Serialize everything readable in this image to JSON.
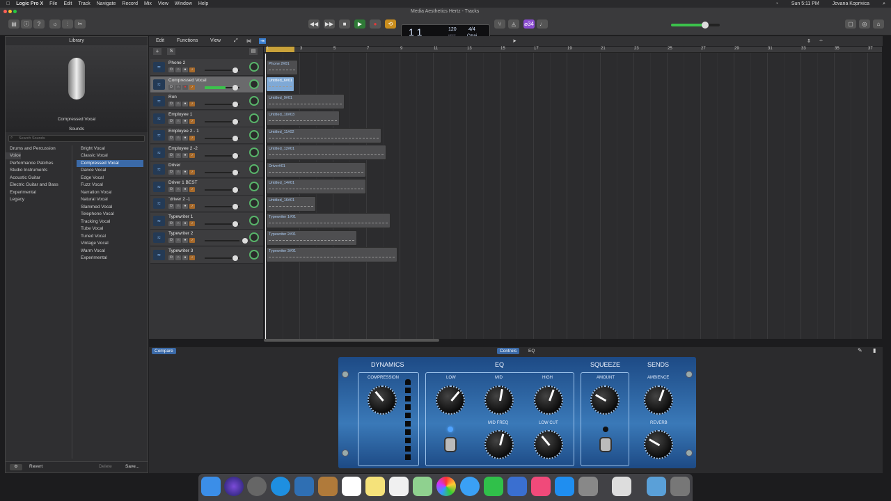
{
  "menubar": {
    "app": "Logic Pro X",
    "items": [
      "File",
      "Edit",
      "Track",
      "Navigate",
      "Record",
      "Mix",
      "View",
      "Window",
      "Help"
    ],
    "right": [
      "Sun 5:11 PM",
      "Jovana Koprivica"
    ]
  },
  "window": {
    "title": "Media Aesthetics Hertz - Tracks"
  },
  "lcd": {
    "position": "1 1",
    "bar_label": "BAR",
    "beat_label": "BEAT",
    "tempo": "120",
    "tempo_label": "KEEP",
    "tempo_sub": "TEMPO",
    "sig": "4/4",
    "key": "Cmaj"
  },
  "toolbar_right": {
    "badge": "⌀34"
  },
  "library": {
    "title": "Library",
    "patch_name": "Compressed Vocal",
    "sounds_label": "Sounds",
    "search_placeholder": "Search Sounds",
    "categories": [
      "Drums and Percussion",
      "Voice",
      "Performance Patches",
      "Studio Instruments",
      "Acoustic Guitar",
      "Electric Guitar and Bass",
      "Experimental",
      "Legacy"
    ],
    "patches": [
      "Bright Vocal",
      "Classic Vocal",
      "Compressed Vocal",
      "Dance Vocal",
      "Edge Vocal",
      "Fuzz Vocal",
      "Narration Vocal",
      "Natural Vocal",
      "Slammed Vocal",
      "Telephone Vocal",
      "Tracking Vocal",
      "Tube Vocal",
      "Tuned Vocal",
      "Vintage Vocal",
      "Warm Vocal",
      "Experimental"
    ],
    "revert": "Revert",
    "delete": "Delete",
    "save": "Save..."
  },
  "editor_menu": [
    "Edit",
    "Functions",
    "View"
  ],
  "ruler": [
    "1",
    "3",
    "5",
    "7",
    "9",
    "11",
    "13",
    "15",
    "17",
    "19",
    "21",
    "23",
    "25",
    "27",
    "29",
    "31",
    "33",
    "35",
    "37"
  ],
  "tracks": [
    {
      "name": "Phone 2",
      "region": "Phone 2#01"
    },
    {
      "name": "Compressed Vocal",
      "region": "Untitled_6#01"
    },
    {
      "name": "Ron",
      "region": "Untitled_9#01"
    },
    {
      "name": "Employee 1",
      "region": "Untitled_10#03"
    },
    {
      "name": "Employee 2 - 1",
      "region": "Untitled_11#02"
    },
    {
      "name": "Employee 2 -2",
      "region": "Untitled_12#01"
    },
    {
      "name": "Driver",
      "region": "Driver#01"
    },
    {
      "name": "Driver 1  BEST",
      "region": "Untitled_14#01"
    },
    {
      "name": "`driver 2 -1",
      "region": "Untitled_16#01"
    },
    {
      "name": "Typewriter 1",
      "region": "Typewriter 1#01"
    },
    {
      "name": "Typewriter 2",
      "region": "Typewriter 2#01"
    },
    {
      "name": "Typewriter 3",
      "region": "Typewriter 3#01"
    }
  ],
  "smart_controls": {
    "compare": "Compare",
    "tab_controls": "Controls",
    "tab_eq": "EQ",
    "sections": [
      "DYNAMICS",
      "EQ",
      "SQUEEZE",
      "SENDS"
    ],
    "knobs": [
      "COMPRESSION",
      "LOW",
      "MID",
      "HIGH",
      "MID FREQ",
      "LOW CUT",
      "AMOUNT",
      "AMBIENCE",
      "REVERB"
    ]
  },
  "colors": {
    "accent": "#3b7fcf",
    "panel_blue": "#2a62a3",
    "pan_green": "#58b46a"
  }
}
